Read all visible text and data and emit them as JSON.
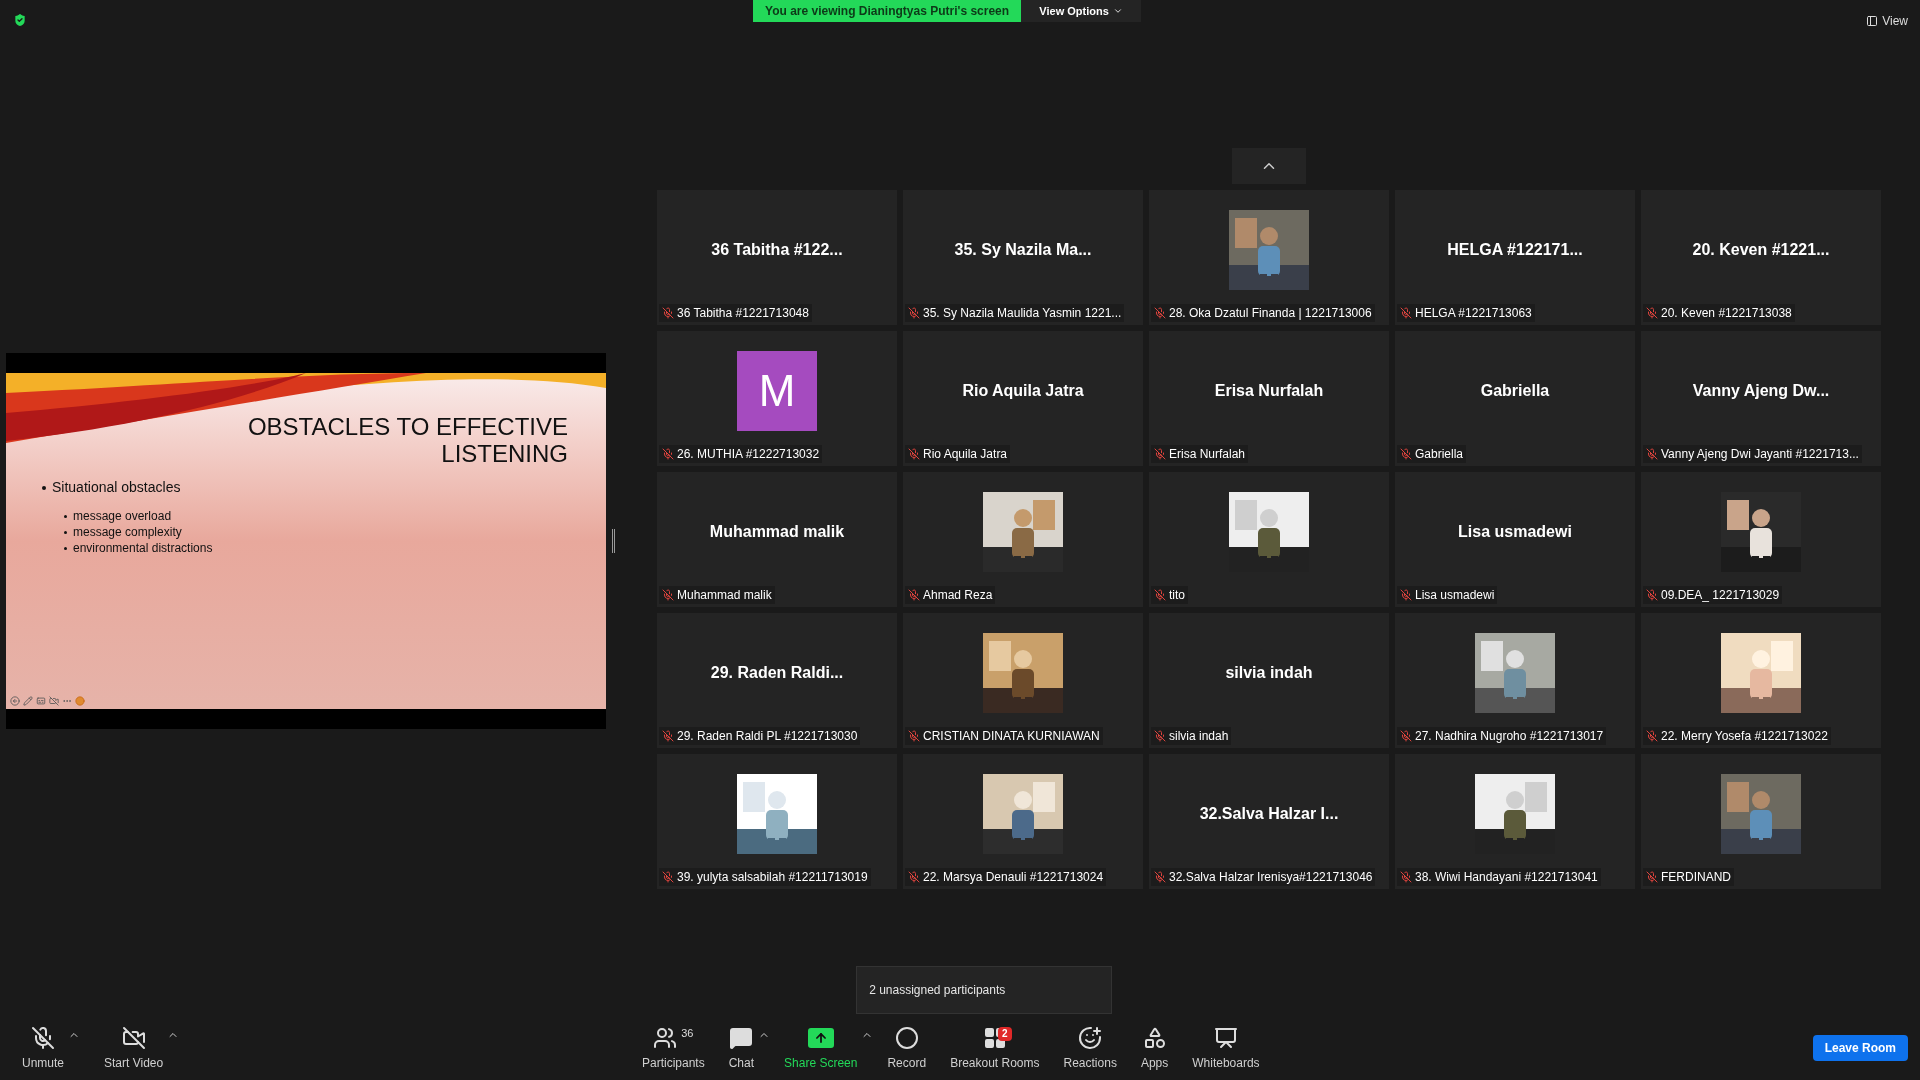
{
  "top_bar": {
    "banner": "You are viewing Dianingtyas Putri's screen",
    "view_options": "View Options",
    "view": "View"
  },
  "slide": {
    "title_lines": [
      "OBSTACLES TO EFFECTIVE",
      "LISTENING"
    ],
    "bullet": "Situational obstacles",
    "sub_bullets": [
      "message overload",
      "message complexity",
      "environmental distractions"
    ]
  },
  "tiles": [
    {
      "kind": "name",
      "display": "36 Tabitha #122...",
      "label": "36 Tabitha #1221713048",
      "muted": true
    },
    {
      "kind": "name",
      "display": "35. Sy Nazila Ma...",
      "label": "35. Sy Nazila Maulida Yasmin 1221...",
      "muted": true
    },
    {
      "kind": "picture",
      "label": "28. Oka Dzatul Finanda | 1221713006",
      "muted": true
    },
    {
      "kind": "name",
      "display": "HELGA #122171...",
      "label": "HELGA #1221713063",
      "muted": true
    },
    {
      "kind": "name",
      "display": "20. Keven #1221...",
      "label": "20. Keven #1221713038",
      "muted": true
    },
    {
      "kind": "avatar",
      "display": "M",
      "label": "26. MUTHIA #1222713032",
      "muted": true
    },
    {
      "kind": "name",
      "display": "Rio Aquila Jatra",
      "label": "Rio Aquila Jatra",
      "muted": true
    },
    {
      "kind": "name",
      "display": "Erisa Nurfalah",
      "label": "Erisa Nurfalah",
      "muted": true
    },
    {
      "kind": "name",
      "display": "Gabriella",
      "label": "Gabriella",
      "muted": true
    },
    {
      "kind": "name",
      "display": "Vanny Ajeng Dw...",
      "label": "Vanny Ajeng Dwi Jayanti #1221713...",
      "muted": true
    },
    {
      "kind": "name",
      "display": "Muhammad malik",
      "label": "Muhammad malik",
      "muted": true
    },
    {
      "kind": "picture",
      "label": "Ahmad Reza",
      "muted": true
    },
    {
      "kind": "picture",
      "label": "tito",
      "muted": true
    },
    {
      "kind": "name",
      "display": "Lisa usmadewi",
      "label": "Lisa usmadewi",
      "muted": true
    },
    {
      "kind": "picture",
      "label": "09.DEA_ 1221713029",
      "muted": true
    },
    {
      "kind": "name",
      "display": "29. Raden Raldi...",
      "label": "29. Raden Raldi PL #1221713030",
      "muted": true
    },
    {
      "kind": "picture",
      "label": "CRISTIAN DINATA KURNIAWAN",
      "muted": true
    },
    {
      "kind": "name",
      "display": "silvia indah",
      "label": "silvia indah",
      "muted": true
    },
    {
      "kind": "picture",
      "label": "27. Nadhira Nugroho #1221713017",
      "muted": true
    },
    {
      "kind": "picture",
      "label": "22. Merry Yosefa #1221713022",
      "muted": true
    },
    {
      "kind": "picture",
      "label": "39. yulyta salsabilah #12211713019",
      "muted": true
    },
    {
      "kind": "picture",
      "label": "22. Marsya Denauli #1221713024",
      "muted": true
    },
    {
      "kind": "name",
      "display": "32.Salva Halzar I...",
      "label": "32.Salva Halzar Irenisya#1221713046",
      "muted": true
    },
    {
      "kind": "picture",
      "label": "38. Wiwi Handayani #1221713041",
      "muted": true
    },
    {
      "kind": "picture",
      "label": "FERDINAND",
      "muted": true
    }
  ],
  "tooltip": "2 unassigned participants",
  "toolbar": {
    "left": [
      {
        "kind": "mic",
        "label": "Unmute"
      },
      {
        "kind": "video",
        "label": "Start Video"
      }
    ],
    "center": [
      {
        "kind": "participants",
        "label": "Participants",
        "count": "36"
      },
      {
        "kind": "chat",
        "label": "Chat"
      },
      {
        "kind": "share",
        "label": "Share Screen"
      },
      {
        "kind": "record",
        "label": "Record"
      },
      {
        "kind": "breakout",
        "label": "Breakout Rooms",
        "badge": "2"
      },
      {
        "kind": "reactions",
        "label": "Reactions"
      },
      {
        "kind": "apps",
        "label": "Apps"
      },
      {
        "kind": "whiteboards",
        "label": "Whiteboards"
      }
    ],
    "leave": "Leave Room"
  }
}
